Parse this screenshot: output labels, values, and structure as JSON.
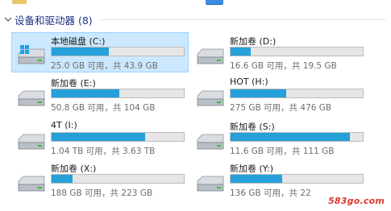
{
  "section": {
    "title": "设备和驱动器 (8)"
  },
  "drives": [
    {
      "name": "本地磁盘 (C:)",
      "info": "25.0 GB 可用，共 43.9 GB",
      "used_fraction": 0.43,
      "selected": true,
      "icon": "windows-drive-icon"
    },
    {
      "name": "新加卷 (D:)",
      "info": "16.6 GB 可用，共 19.5 GB",
      "used_fraction": 0.15,
      "selected": false,
      "icon": "hard-drive-icon"
    },
    {
      "name": "新加卷 (E:)",
      "info": "50.8 GB 可用，共 104 GB",
      "used_fraction": 0.51,
      "selected": false,
      "icon": "hard-drive-icon"
    },
    {
      "name": "HOT (H:)",
      "info": "275 GB 可用，共 476 GB",
      "used_fraction": 0.42,
      "selected": false,
      "icon": "hard-drive-icon"
    },
    {
      "name": "4T (I:)",
      "info": "1.04 TB 可用，共 3.63 TB",
      "used_fraction": 0.71,
      "selected": false,
      "icon": "hard-drive-icon"
    },
    {
      "name": "新加卷 (S:)",
      "info": "11.6 GB 可用，共 111 GB",
      "used_fraction": 0.9,
      "selected": false,
      "icon": "hard-drive-icon"
    },
    {
      "name": "新加卷 (X:)",
      "info": "188 GB 可用，共 223 GB",
      "used_fraction": 0.16,
      "selected": false,
      "icon": "hard-drive-icon"
    },
    {
      "name": "新加卷 (Y:)",
      "info": "136 GB 可用，共 22",
      "used_fraction": 0.39,
      "selected": false,
      "icon": "hard-drive-icon"
    }
  ],
  "watermark": "583go.com",
  "colors": {
    "bar_fill": "#26a0da",
    "selection_bg": "#cce8ff",
    "header_text": "#1e3287"
  }
}
